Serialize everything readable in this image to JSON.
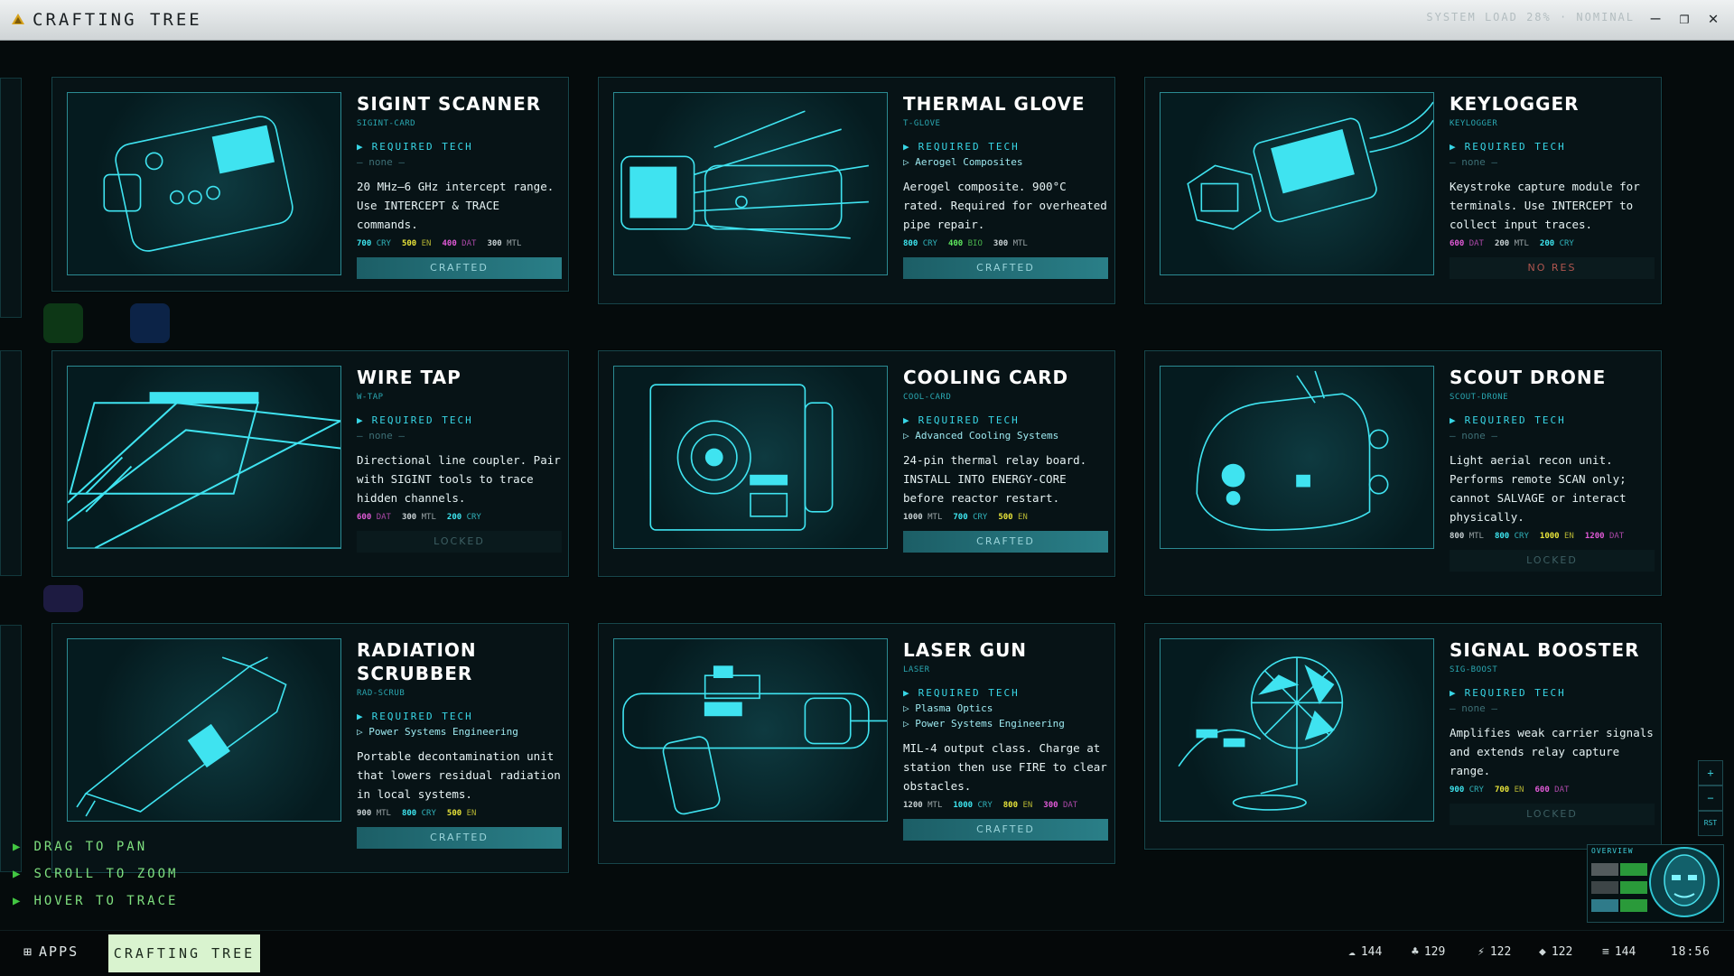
{
  "window": {
    "title": "CRAFTING TREE",
    "system_load_text": "SYSTEM LOAD 28% · NOMINAL"
  },
  "cards": [
    {
      "name": "SIGINT SCANNER",
      "code": "SIGINT-CARD",
      "req_label": "REQUIRED TECH",
      "tech": [
        "— none —"
      ],
      "tech_none": true,
      "desc": "20 MHz–6 GHz intercept range. Use INTERCEPT & TRACE commands.",
      "costs": [
        {
          "v": "700",
          "u": "CRY",
          "color": "#3ee6f0"
        },
        {
          "v": "500",
          "u": "EN",
          "color": "#e8e43a"
        },
        {
          "v": "400",
          "u": "DAT",
          "color": "#e25ad8"
        },
        {
          "v": "300",
          "u": "MTL",
          "color": "#c9d2d4"
        }
      ],
      "status": "CRAFTED",
      "status_type": "crafted"
    },
    {
      "name": "THERMAL GLOVE",
      "code": "T-GLOVE",
      "req_label": "REQUIRED TECH",
      "tech": [
        "Aerogel Composites"
      ],
      "tech_none": false,
      "desc": "Aerogel composite. 900°C rated. Required for overheated pipe repair.",
      "costs": [
        {
          "v": "800",
          "u": "CRY",
          "color": "#3ee6f0"
        },
        {
          "v": "400",
          "u": "BIO",
          "color": "#5ee85e"
        },
        {
          "v": "300",
          "u": "MTL",
          "color": "#c9d2d4"
        }
      ],
      "status": "CRAFTED",
      "status_type": "crafted"
    },
    {
      "name": "KEYLOGGER",
      "code": "KEYLOGGER",
      "req_label": "REQUIRED TECH",
      "tech": [
        "— none —"
      ],
      "tech_none": true,
      "desc": "Keystroke capture module for terminals. Use INTERCEPT to collect input traces.",
      "costs": [
        {
          "v": "600",
          "u": "DAT",
          "color": "#e25ad8"
        },
        {
          "v": "200",
          "u": "MTL",
          "color": "#c9d2d4"
        },
        {
          "v": "200",
          "u": "CRY",
          "color": "#3ee6f0"
        }
      ],
      "status": "NO RES",
      "status_type": "nores"
    },
    {
      "name": "WIRE TAP",
      "code": "W-TAP",
      "req_label": "REQUIRED TECH",
      "tech": [
        "— none —"
      ],
      "tech_none": true,
      "desc": "Directional line coupler. Pair with SIGINT tools to trace hidden channels.",
      "costs": [
        {
          "v": "600",
          "u": "DAT",
          "color": "#e25ad8"
        },
        {
          "v": "300",
          "u": "MTL",
          "color": "#c9d2d4"
        },
        {
          "v": "200",
          "u": "CRY",
          "color": "#3ee6f0"
        }
      ],
      "status": "LOCKED",
      "status_type": "locked"
    },
    {
      "name": "COOLING CARD",
      "code": "COOL-CARD",
      "req_label": "REQUIRED TECH",
      "tech": [
        "Advanced Cooling Systems"
      ],
      "tech_none": false,
      "desc": "24-pin thermal relay board. INSTALL INTO ENERGY-CORE before reactor restart.",
      "costs": [
        {
          "v": "1000",
          "u": "MTL",
          "color": "#c9d2d4"
        },
        {
          "v": "700",
          "u": "CRY",
          "color": "#3ee6f0"
        },
        {
          "v": "500",
          "u": "EN",
          "color": "#e8e43a"
        }
      ],
      "status": "CRAFTED",
      "status_type": "crafted"
    },
    {
      "name": "SCOUT DRONE",
      "code": "SCOUT-DRONE",
      "req_label": "REQUIRED TECH",
      "tech": [
        "— none —"
      ],
      "tech_none": true,
      "desc": "Light aerial recon unit. Performs remote SCAN only; cannot SALVAGE or interact physically.",
      "costs": [
        {
          "v": "800",
          "u": "MTL",
          "color": "#c9d2d4"
        },
        {
          "v": "800",
          "u": "CRY",
          "color": "#3ee6f0"
        },
        {
          "v": "1000",
          "u": "EN",
          "color": "#e8e43a"
        },
        {
          "v": "1200",
          "u": "DAT",
          "color": "#e25ad8"
        }
      ],
      "status": "LOCKED",
      "status_type": "locked"
    },
    {
      "name": "RADIATION SCRUBBER",
      "code": "RAD-SCRUB",
      "req_label": "REQUIRED TECH",
      "tech": [
        "Power Systems Engineering"
      ],
      "tech_none": false,
      "desc": "Portable decontamination unit that lowers residual radiation in local systems.",
      "costs": [
        {
          "v": "900",
          "u": "MTL",
          "color": "#c9d2d4"
        },
        {
          "v": "800",
          "u": "CRY",
          "color": "#3ee6f0"
        },
        {
          "v": "500",
          "u": "EN",
          "color": "#e8e43a"
        }
      ],
      "status": "CRAFTED",
      "status_type": "crafted"
    },
    {
      "name": "LASER GUN",
      "code": "LASER",
      "req_label": "REQUIRED TECH",
      "tech": [
        "Plasma Optics",
        "Power Systems Engineering"
      ],
      "tech_none": false,
      "desc": "MIL-4 output class. Charge at station then use FIRE to clear obstacles.",
      "costs": [
        {
          "v": "1200",
          "u": "MTL",
          "color": "#c9d2d4"
        },
        {
          "v": "1000",
          "u": "CRY",
          "color": "#3ee6f0"
        },
        {
          "v": "800",
          "u": "EN",
          "color": "#e8e43a"
        },
        {
          "v": "300",
          "u": "DAT",
          "color": "#e25ad8"
        }
      ],
      "status": "CRAFTED",
      "status_type": "crafted"
    },
    {
      "name": "SIGNAL BOOSTER",
      "code": "SIG-BOOST",
      "req_label": "REQUIRED TECH",
      "tech": [
        "— none —"
      ],
      "tech_none": true,
      "desc": "Amplifies weak carrier signals and extends relay capture range.",
      "costs": [
        {
          "v": "900",
          "u": "CRY",
          "color": "#3ee6f0"
        },
        {
          "v": "700",
          "u": "EN",
          "color": "#e8e43a"
        },
        {
          "v": "600",
          "u": "DAT",
          "color": "#e25ad8"
        }
      ],
      "status": "LOCKED",
      "status_type": "locked"
    }
  ],
  "hints": [
    "DRAG TO PAN",
    "SCROLL TO ZOOM",
    "HOVER TO TRACE"
  ],
  "taskbar": {
    "apps_label": "APPS",
    "active_task": "CRAFTING TREE",
    "resources": [
      {
        "icon": "cloud-icon",
        "glyph": "☁",
        "value": "144"
      },
      {
        "icon": "plant-icon",
        "glyph": "♣",
        "value": "129"
      },
      {
        "icon": "bolt-icon",
        "glyph": "⚡",
        "value": "122"
      },
      {
        "icon": "crystal-icon",
        "glyph": "◆",
        "value": "122"
      },
      {
        "icon": "data-stack-icon",
        "glyph": "≡",
        "value": "144"
      }
    ],
    "clock": "18:56"
  },
  "zoom": {
    "in": "+",
    "out": "−",
    "reset": "RST"
  },
  "overview_label": "OVERVIEW"
}
